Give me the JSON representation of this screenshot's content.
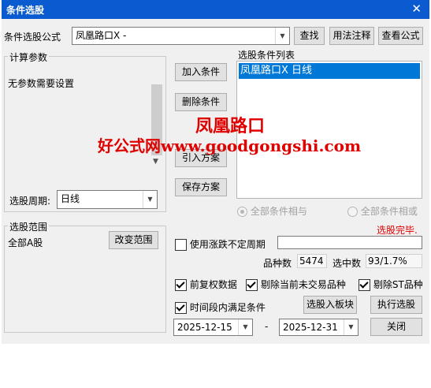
{
  "window": {
    "title": "条件选股",
    "close_glyph": "✕"
  },
  "formula": {
    "label": "条件选股公式",
    "selected": "凤凰路口X  -",
    "find_button": "查找",
    "usage_button": "用法注释",
    "view_button": "查看公式"
  },
  "params": {
    "group_label": "计算参数",
    "message": "无参数需要设置",
    "period_label": "选股周期:",
    "period_value": "日线"
  },
  "actions": {
    "add": "加入条件",
    "delete": "删除条件",
    "import": "引入方案",
    "save": "保存方案"
  },
  "conditions": {
    "label": "选股条件列表",
    "items": [
      "凤凰路口X  日线"
    ],
    "radio_and": "全部条件相与",
    "radio_or": "全部条件相或",
    "status": "选股完毕."
  },
  "range": {
    "group_label": "选股范围",
    "value": "全部A股",
    "change_button": "改变范围"
  },
  "options": {
    "uncertain_period": "使用涨跌不定周期",
    "count_label": "品种数",
    "count_value": "5474",
    "selected_label": "选中数",
    "selected_value": "93/1.7%",
    "fq": "前复权数据",
    "exclude_untraded": "剔除当前未交易品种",
    "exclude_st": "剔除ST品种",
    "period_satisfy": "时间段内满足条件",
    "to_block_button": "选股入板块",
    "execute_button": "执行选股",
    "start_date": "2025-12-15",
    "dash": "-",
    "end_date": "2025-12-31",
    "close_button": "关闭"
  },
  "watermark": {
    "line1": "凤凰路口",
    "line2": "好公式网www.goodgongshi.com"
  },
  "colors": {
    "title_bar": "#0a5bcf",
    "selection": "#0078d7",
    "status": "#e00000"
  }
}
